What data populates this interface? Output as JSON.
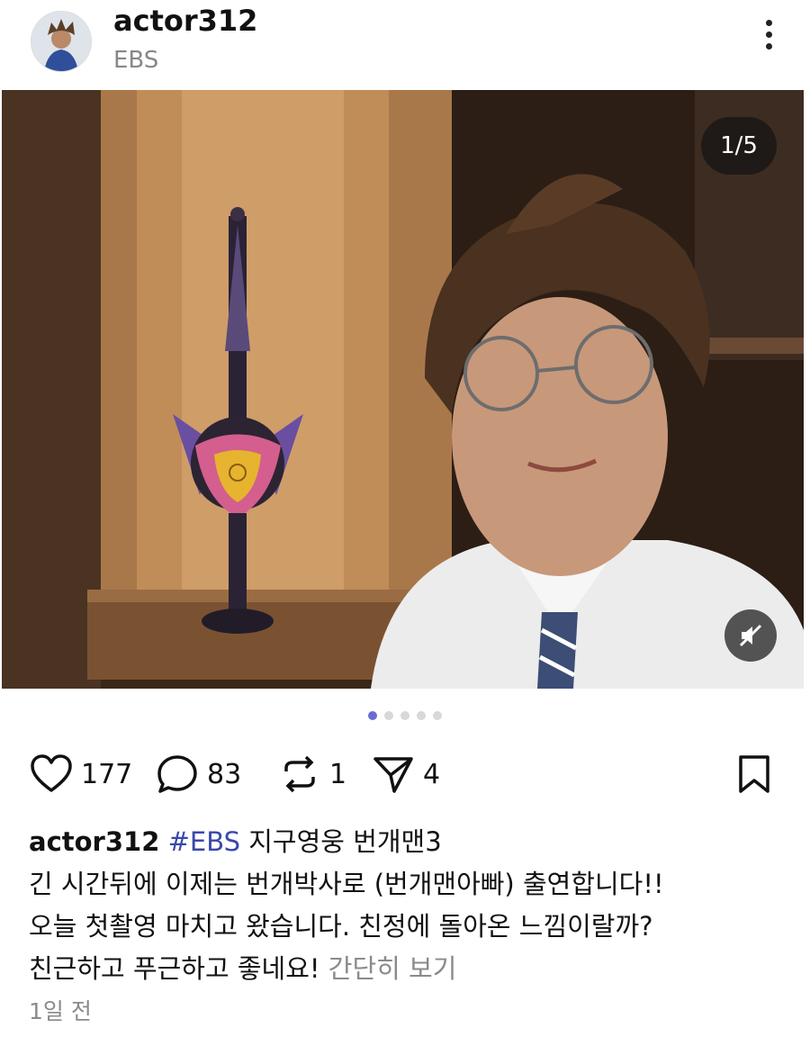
{
  "header": {
    "username": "actor312",
    "subtitle": "EBS"
  },
  "media": {
    "counter": "1/5",
    "total_slides": 5,
    "active_slide": 1
  },
  "actions": {
    "likes": "177",
    "comments": "83",
    "reposts": "1",
    "shares": "4"
  },
  "caption": {
    "username": "actor312",
    "hashtag": "#EBS",
    "title": " 지구영웅 번개맨3",
    "line1": "긴 시간뒤에 이제는 번개박사로 (번개맨아빠) 출연합니다!!",
    "line2": "오늘 첫촬영 마치고 왔습니다. 친정에 돌아온 느낌이랄까?",
    "line3": "친근하고 푸근하고 좋네요! ",
    "more": "간단히 보기"
  },
  "time": "1일 전",
  "colors": {
    "hashtag": "#3949ab",
    "dot_active": "#6b6bd6",
    "muted_text": "#8a8a8a"
  }
}
